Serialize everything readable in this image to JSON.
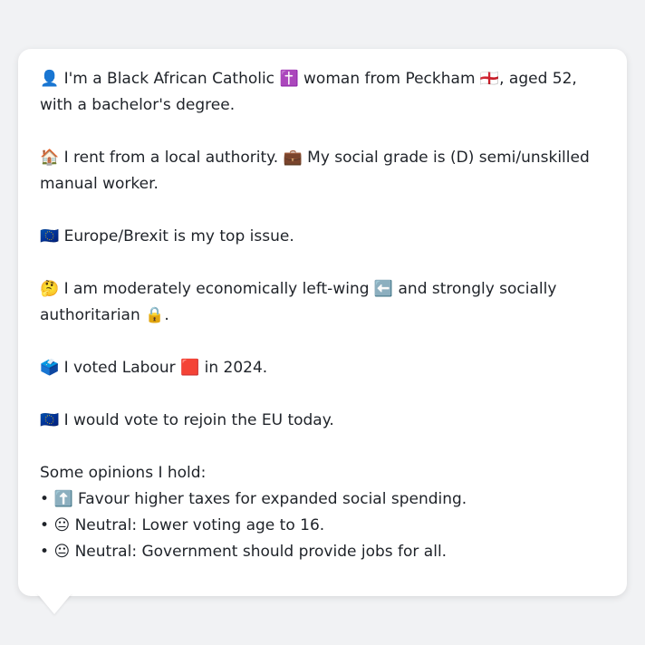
{
  "message": {
    "identity": {
      "icon": "👤",
      "before_religion": "I'm a Black African Catholic",
      "religion_icon": "✝️",
      "before_flag": "woman from Peckham",
      "flag_icon": "🏴󠁧󠁢󠁥󠁮󠁧󠁿",
      "after_flag": ", aged 52, with a bachelor's degree."
    },
    "housing": {
      "icon": "🏠",
      "text": "I rent from a local authority.",
      "grade_icon": "💼",
      "grade_text": "My social grade is (D) semi/unskilled manual worker."
    },
    "top_issue": {
      "icon": "🇪🇺",
      "text": "Europe/Brexit is my top issue."
    },
    "ideology": {
      "icon": "🤔",
      "before_left": "I am moderately economically left-wing",
      "left_icon": "⬅️",
      "middle": "and strongly socially authoritarian",
      "lock_icon": "🔒",
      "end": "."
    },
    "vote_2024": {
      "icon": "🗳️",
      "before_party": "I voted Labour",
      "party_icon": "🟥",
      "after_party": "in 2024."
    },
    "eu": {
      "icon": "🇪🇺",
      "text": "I would vote to rejoin the EU today."
    },
    "opinions_heading": "Some opinions I hold:",
    "opinions": [
      {
        "bullet": "•",
        "icon": "⬆️",
        "text": "Favour higher taxes for expanded social spending."
      },
      {
        "bullet": "•",
        "icon": "😐",
        "text": "Neutral: Lower voting age to 16."
      },
      {
        "bullet": "•",
        "icon": "😐",
        "text": "Neutral: Government should provide jobs for all."
      }
    ]
  }
}
